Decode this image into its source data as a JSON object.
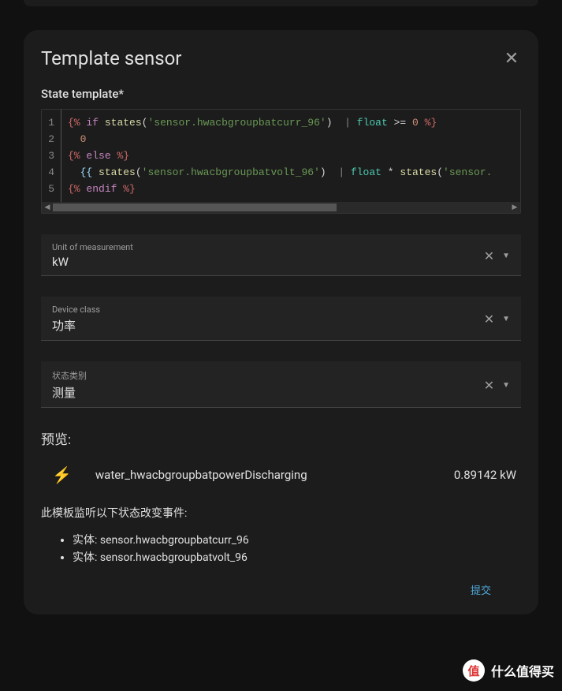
{
  "dialog": {
    "title": "Template sensor",
    "state_template_label": "State template*"
  },
  "code": {
    "lines": [
      {
        "n": "1",
        "html": "<span class='tok-delim'>{%</span> <span class='tok-kw'>if</span> <span class='tok-fn'>states</span><span class='tok-op'>(</span><span class='tok-str'>'sensor.hwacbgroupbatcurr_96'</span><span class='tok-op'>)</span>  <span class='tok-pipe'>|</span> <span class='tok-type'>float</span> <span class='tok-op'>&gt;=</span> <span class='tok-num'>0</span> <span class='tok-delim'>%}</span>"
      },
      {
        "n": "2",
        "html": "  <span class='tok-num'>0</span>"
      },
      {
        "n": "3",
        "html": "<span class='tok-delim'>{%</span> <span class='tok-kw'>else</span> <span class='tok-delim'>%}</span>"
      },
      {
        "n": "4",
        "html": "  <span class='tok-var'>{{</span> <span class='tok-fn'>states</span><span class='tok-op'>(</span><span class='tok-str'>'sensor.hwacbgroupbatvolt_96'</span><span class='tok-op'>)</span>  <span class='tok-pipe'>|</span> <span class='tok-type'>float</span> <span class='tok-op'>*</span> <span class='tok-fn'>states</span><span class='tok-op'>(</span><span class='tok-str'>'sensor.</span>"
      },
      {
        "n": "5",
        "html": "<span class='tok-delim'>{%</span> <span class='tok-kw'>endif</span> <span class='tok-delim'>%}</span>"
      }
    ]
  },
  "fields": {
    "unit": {
      "label": "Unit of measurement",
      "value": "kW"
    },
    "device_class": {
      "label": "Device class",
      "value": "功率"
    },
    "state_class": {
      "label": "状态类别",
      "value": "测量"
    }
  },
  "preview": {
    "label": "预览:",
    "entity_name": "water_hwacbgroupbatpowerDischarging",
    "entity_value": "0.89142 kW"
  },
  "listens": {
    "label": "此模板监听以下状态改变事件:",
    "prefix": "实体: ",
    "entities": [
      "sensor.hwacbgroupbatcurr_96",
      "sensor.hwacbgroupbatvolt_96"
    ]
  },
  "submit_label": "提交",
  "watermark": {
    "badge": "值",
    "text": "什么值得买"
  }
}
